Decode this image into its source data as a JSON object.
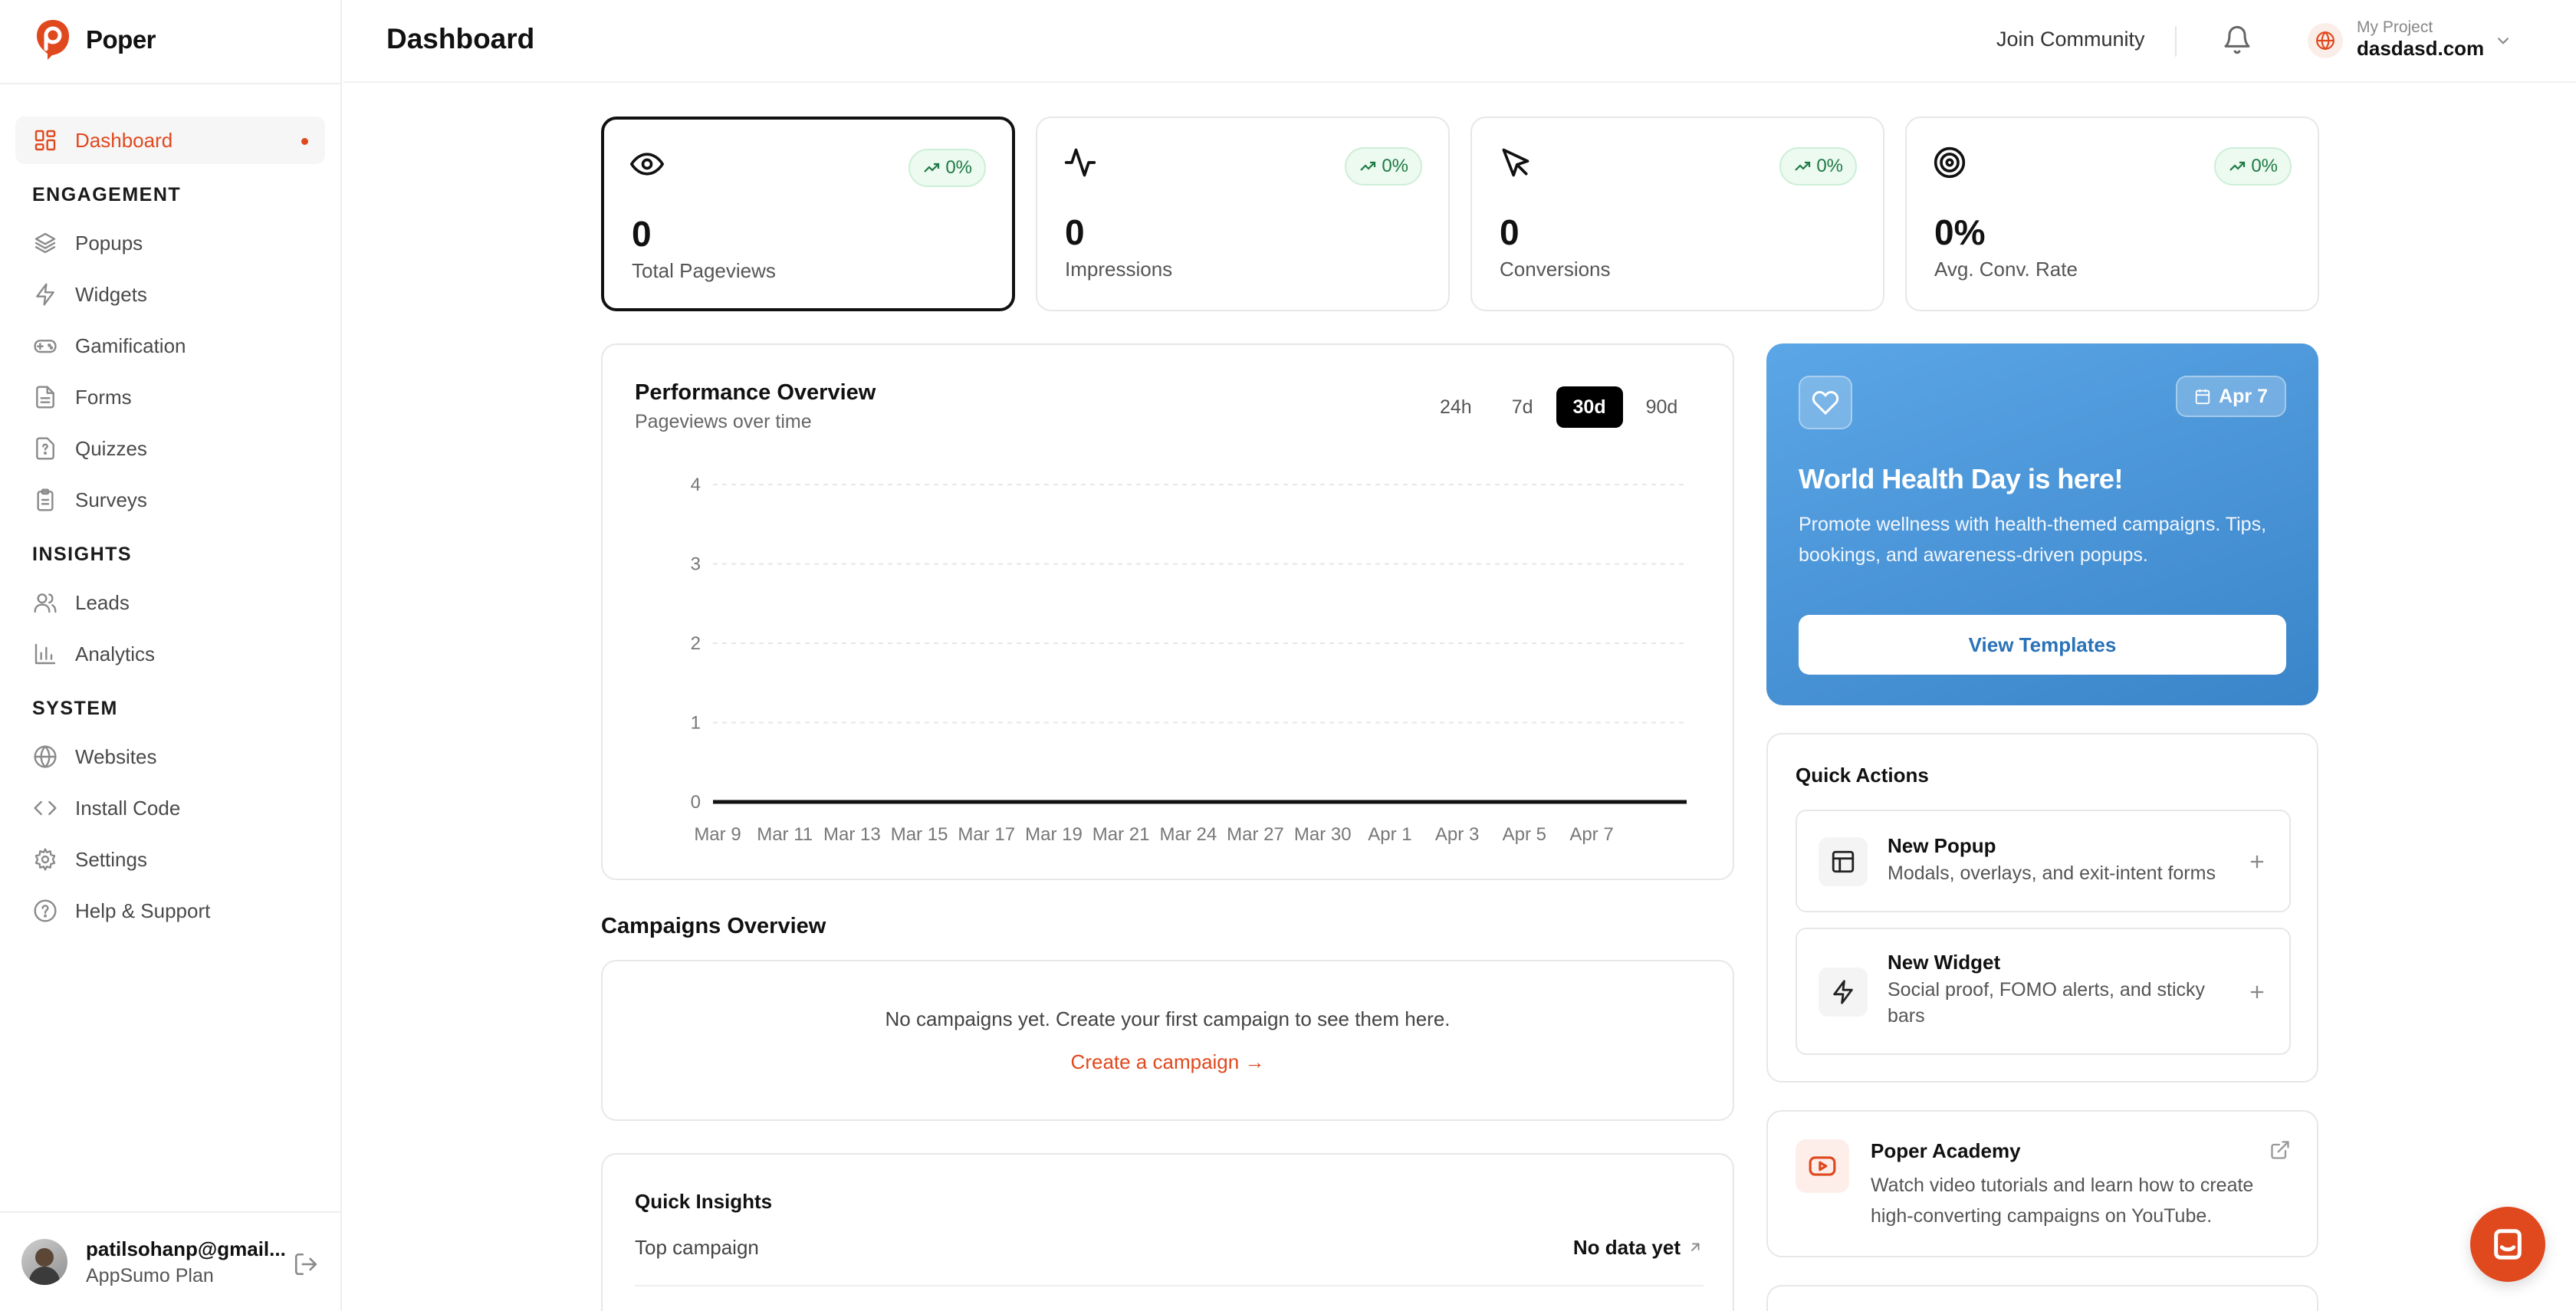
{
  "brand": {
    "name": "Poper"
  },
  "sidebar": {
    "active_item": {
      "label": "Dashboard",
      "icon": "dashboard-icon"
    },
    "sections": [
      {
        "title": "ENGAGEMENT",
        "items": [
          {
            "label": "Popups",
            "icon": "layers-icon"
          },
          {
            "label": "Widgets",
            "icon": "zap-icon"
          },
          {
            "label": "Gamification",
            "icon": "gamepad-icon"
          },
          {
            "label": "Forms",
            "icon": "file-icon"
          },
          {
            "label": "Quizzes",
            "icon": "quiz-icon"
          },
          {
            "label": "Surveys",
            "icon": "clipboard-icon"
          }
        ]
      },
      {
        "title": "INSIGHTS",
        "items": [
          {
            "label": "Leads",
            "icon": "users-icon"
          },
          {
            "label": "Analytics",
            "icon": "bar-chart-icon"
          }
        ]
      },
      {
        "title": "SYSTEM",
        "items": [
          {
            "label": "Websites",
            "icon": "globe-icon"
          },
          {
            "label": "Install Code",
            "icon": "code-icon"
          },
          {
            "label": "Settings",
            "icon": "gear-icon"
          },
          {
            "label": "Help & Support",
            "icon": "help-icon"
          }
        ]
      }
    ],
    "user": {
      "email": "patilsohanp@gmail...",
      "plan": "AppSumo Plan"
    }
  },
  "header": {
    "title": "Dashboard",
    "join_community": "Join Community",
    "project_label": "My Project",
    "project_name": "dasdasd.com"
  },
  "stats": [
    {
      "value": "0",
      "label": "Total Pageviews",
      "change": "0%",
      "icon": "eye-icon"
    },
    {
      "value": "0",
      "label": "Impressions",
      "change": "0%",
      "icon": "activity-icon"
    },
    {
      "value": "0",
      "label": "Conversions",
      "change": "0%",
      "icon": "cursor-icon"
    },
    {
      "value": "0%",
      "label": "Avg. Conv. Rate",
      "change": "0%",
      "icon": "target-icon"
    }
  ],
  "performance": {
    "title": "Performance Overview",
    "subtitle": "Pageviews over time",
    "ranges": [
      "24h",
      "7d",
      "30d",
      "90d"
    ],
    "active_range": "30d"
  },
  "chart_data": {
    "type": "line",
    "title": "Performance Overview",
    "subtitle": "Pageviews over time",
    "x": [
      "Mar 9",
      "Mar 11",
      "Mar 13",
      "Mar 15",
      "Mar 17",
      "Mar 19",
      "Mar 21",
      "Mar 24",
      "Mar 27",
      "Mar 30",
      "Apr 1",
      "Apr 3",
      "Apr 5",
      "Apr 7"
    ],
    "series": [
      {
        "values": [
          0,
          0,
          0,
          0,
          0,
          0,
          0,
          0,
          0,
          0,
          0,
          0,
          0,
          0
        ]
      }
    ],
    "yticks": [
      0,
      1,
      2,
      3,
      4
    ],
    "ylim": [
      0,
      4
    ],
    "grid": true,
    "line_color": "#111111"
  },
  "campaigns": {
    "title": "Campaigns Overview",
    "empty_text": "No campaigns yet. Create your first campaign to see them here.",
    "create_link": "Create a campaign →"
  },
  "insights": {
    "title": "Quick Insights",
    "rows": [
      {
        "label": "Top campaign",
        "value": "No data yet"
      }
    ]
  },
  "promo": {
    "date": "Apr 7",
    "title": "World Health Day is here!",
    "text": "Promote wellness with health-themed campaigns. Tips, bookings, and awareness-driven popups.",
    "button": "View Templates",
    "gradient": [
      "#5ba6e6",
      "#3a84c9"
    ]
  },
  "quick_actions": {
    "title": "Quick Actions",
    "items": [
      {
        "name": "New Popup",
        "desc": "Modals, overlays, and exit-intent forms",
        "icon": "layout-icon"
      },
      {
        "name": "New Widget",
        "desc": "Social proof, FOMO alerts, and sticky bars",
        "icon": "zap-icon"
      }
    ]
  },
  "academy": {
    "title": "Poper Academy",
    "text": "Watch video tutorials and learn how to create high-converting campaigns on YouTube.",
    "icon": "youtube-icon"
  },
  "colors": {
    "accent": "#e0481e",
    "positive": "#1e7a44"
  }
}
